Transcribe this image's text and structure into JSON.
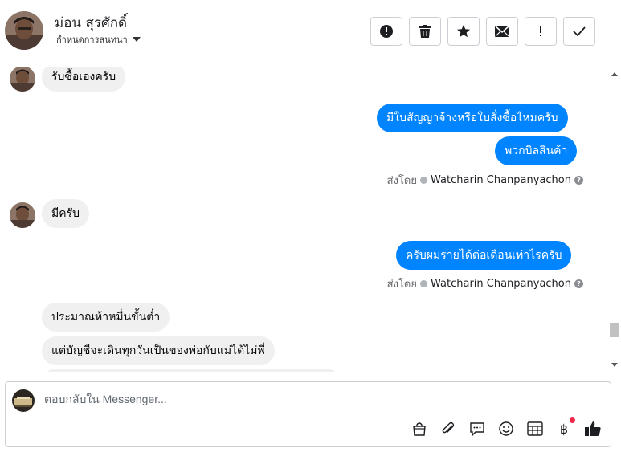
{
  "header": {
    "contact_name": "ม่อน สุรศักดิ์",
    "conversation_settings_label": "กำหนดการสนทนา",
    "actions": [
      "report-icon",
      "trash-icon",
      "star-icon",
      "envelope-icon",
      "exclamation-icon",
      "check-icon"
    ]
  },
  "thread": {
    "messages": [
      {
        "direction": "incoming",
        "text": "รับซื้อเองครับ"
      },
      {
        "direction": "outgoing",
        "text": "มีใบสัญญาจ้างหรือใบสั่งซื้อไหมครับ"
      },
      {
        "direction": "outgoing",
        "text": "พวกบิลสินค้า"
      },
      {
        "direction": "incoming",
        "text": "มีครับ"
      },
      {
        "direction": "outgoing",
        "text": "ครับผมรายได้ต่อเดือนเท่าไรครับ"
      },
      {
        "direction": "incoming",
        "text": "ประมาณห้าหมื่นขั้นต่ำ"
      },
      {
        "direction": "incoming",
        "text": "แต่บัญชีจะเดินทุกวันเป็นของพ่อกับแม่ได้ไม่พี่"
      }
    ],
    "sent_by_label": "ส่งโดย",
    "sent_by_agent": "Watcharin Chanpanyachon",
    "help_glyph": "?"
  },
  "composer": {
    "placeholder": "ตอบกลับใน Messenger...",
    "tools": [
      "shopping-bag-icon",
      "paperclip-icon",
      "saved-reply-icon",
      "emoji-icon",
      "calendar-icon",
      "baht-icon",
      "like-icon"
    ],
    "baht_glyph": "฿"
  },
  "colors": {
    "outgoing_bubble": "#0084ff",
    "incoming_bubble": "#f0f0f0",
    "notification_dot": "#f02849"
  }
}
